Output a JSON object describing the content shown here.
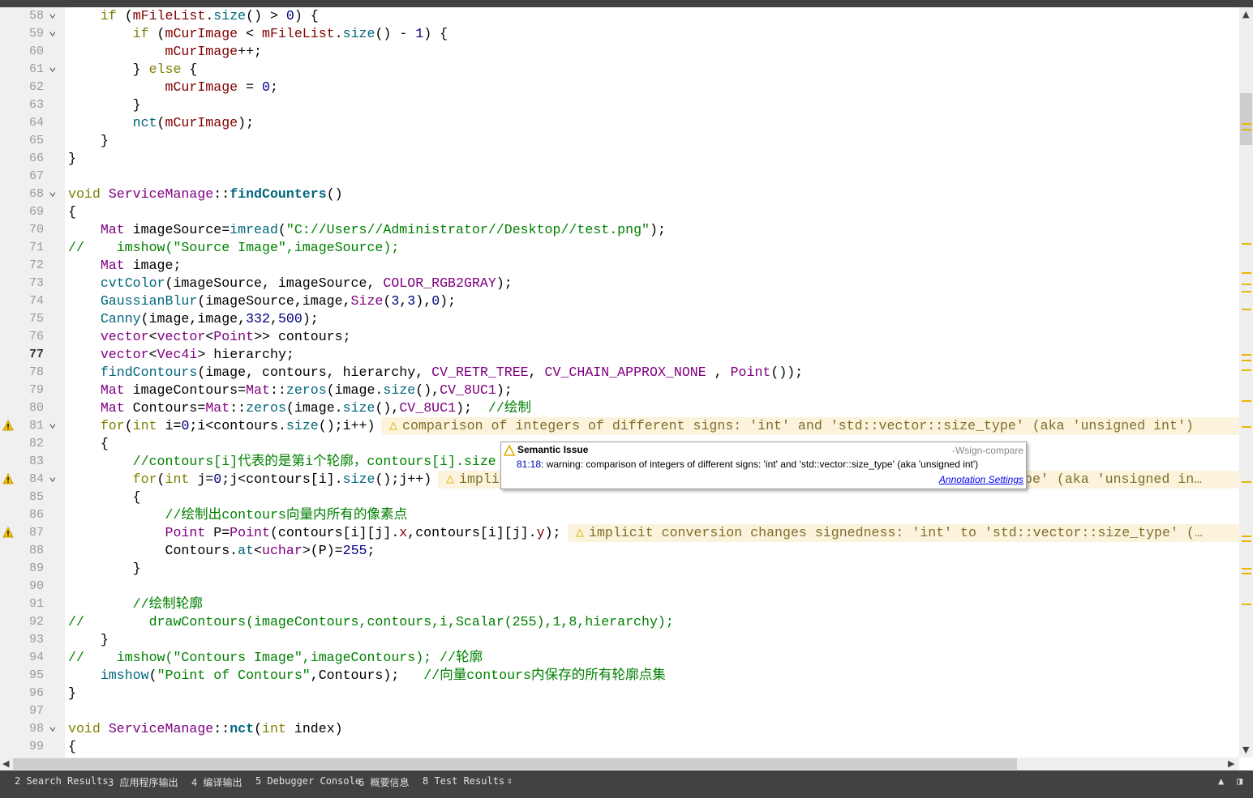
{
  "editor": {
    "current_line": 77,
    "fold_lines": [
      58,
      59,
      61,
      68,
      81,
      84,
      98
    ],
    "warning_lines": [
      81,
      84,
      87
    ],
    "lines": [
      {
        "n": 58,
        "t": [
          [
            "p",
            "    "
          ],
          [
            "k",
            "if"
          ],
          [
            "p",
            " ("
          ],
          [
            "m",
            "mFileList"
          ],
          [
            "p",
            "."
          ],
          [
            "f",
            "size"
          ],
          [
            "p",
            "() > "
          ],
          [
            "n",
            "0"
          ],
          [
            "p",
            ") {"
          ]
        ]
      },
      {
        "n": 59,
        "t": [
          [
            "p",
            "        "
          ],
          [
            "k",
            "if"
          ],
          [
            "p",
            " ("
          ],
          [
            "m",
            "mCurImage"
          ],
          [
            "p",
            " < "
          ],
          [
            "m",
            "mFileList"
          ],
          [
            "p",
            "."
          ],
          [
            "f",
            "size"
          ],
          [
            "p",
            "() - "
          ],
          [
            "n",
            "1"
          ],
          [
            "p",
            ") {"
          ]
        ]
      },
      {
        "n": 60,
        "t": [
          [
            "p",
            "            "
          ],
          [
            "m",
            "mCurImage"
          ],
          [
            "p",
            "++;"
          ]
        ]
      },
      {
        "n": 61,
        "t": [
          [
            "p",
            "        } "
          ],
          [
            "k",
            "else"
          ],
          [
            "p",
            " {"
          ]
        ]
      },
      {
        "n": 62,
        "t": [
          [
            "p",
            "            "
          ],
          [
            "m",
            "mCurImage"
          ],
          [
            "p",
            " = "
          ],
          [
            "n",
            "0"
          ],
          [
            "p",
            ";"
          ]
        ]
      },
      {
        "n": 63,
        "t": [
          [
            "p",
            "        }"
          ]
        ]
      },
      {
        "n": 64,
        "t": [
          [
            "p",
            "        "
          ],
          [
            "f",
            "nct"
          ],
          [
            "p",
            "("
          ],
          [
            "m",
            "mCurImage"
          ],
          [
            "p",
            ");"
          ]
        ]
      },
      {
        "n": 65,
        "t": [
          [
            "p",
            "    }"
          ]
        ]
      },
      {
        "n": 66,
        "t": [
          [
            "p",
            "}"
          ]
        ]
      },
      {
        "n": 67,
        "t": []
      },
      {
        "n": 68,
        "t": [
          [
            "k",
            "void"
          ],
          [
            "p",
            " "
          ],
          [
            "t",
            "ServiceManage"
          ],
          [
            "p",
            "::"
          ],
          [
            "fb",
            "findCounters"
          ],
          [
            "p",
            "()"
          ]
        ]
      },
      {
        "n": 69,
        "t": [
          [
            "p",
            "{"
          ]
        ]
      },
      {
        "n": 70,
        "t": [
          [
            "p",
            "    "
          ],
          [
            "t",
            "Mat"
          ],
          [
            "p",
            " imageSource="
          ],
          [
            "f",
            "imread"
          ],
          [
            "p",
            "("
          ],
          [
            "s",
            "\"C://Users//Administrator//Desktop//test.png\""
          ],
          [
            "p",
            ");"
          ]
        ]
      },
      {
        "n": 71,
        "t": [
          [
            "c",
            "//    imshow(\"Source Image\",imageSource);"
          ]
        ]
      },
      {
        "n": 72,
        "t": [
          [
            "p",
            "    "
          ],
          [
            "t",
            "Mat"
          ],
          [
            "p",
            " image;"
          ]
        ]
      },
      {
        "n": 73,
        "t": [
          [
            "p",
            "    "
          ],
          [
            "f",
            "cvtColor"
          ],
          [
            "p",
            "(imageSource, imageSource, "
          ],
          [
            "t",
            "COLOR_RGB2GRAY"
          ],
          [
            "p",
            ");"
          ]
        ]
      },
      {
        "n": 74,
        "t": [
          [
            "p",
            "    "
          ],
          [
            "f",
            "GaussianBlur"
          ],
          [
            "p",
            "(imageSource,image,"
          ],
          [
            "t",
            "Size"
          ],
          [
            "p",
            "("
          ],
          [
            "n",
            "3"
          ],
          [
            "p",
            ","
          ],
          [
            "n",
            "3"
          ],
          [
            "p",
            "),"
          ],
          [
            "n",
            "0"
          ],
          [
            "p",
            ");"
          ]
        ]
      },
      {
        "n": 75,
        "t": [
          [
            "p",
            "    "
          ],
          [
            "f",
            "Canny"
          ],
          [
            "p",
            "(image,image,"
          ],
          [
            "n",
            "332"
          ],
          [
            "p",
            ","
          ],
          [
            "n",
            "500"
          ],
          [
            "p",
            ");"
          ]
        ]
      },
      {
        "n": 76,
        "t": [
          [
            "p",
            "    "
          ],
          [
            "t",
            "vector"
          ],
          [
            "p",
            "<"
          ],
          [
            "t",
            "vector"
          ],
          [
            "p",
            "<"
          ],
          [
            "t",
            "Point"
          ],
          [
            "p",
            ">> contours;"
          ]
        ]
      },
      {
        "n": 77,
        "t": [
          [
            "p",
            "    "
          ],
          [
            "t",
            "vector"
          ],
          [
            "p",
            "<"
          ],
          [
            "t",
            "Vec4i"
          ],
          [
            "p",
            "> hierarchy;"
          ]
        ]
      },
      {
        "n": 78,
        "t": [
          [
            "p",
            "    "
          ],
          [
            "f",
            "findContours"
          ],
          [
            "p",
            "(image, contours, hierarchy, "
          ],
          [
            "t",
            "CV_RETR_TREE"
          ],
          [
            "p",
            ", "
          ],
          [
            "t",
            "CV_CHAIN_APPROX_NONE"
          ],
          [
            "p",
            " , "
          ],
          [
            "t",
            "Point"
          ],
          [
            "p",
            "());"
          ]
        ]
      },
      {
        "n": 79,
        "t": [
          [
            "p",
            "    "
          ],
          [
            "t",
            "Mat"
          ],
          [
            "p",
            " imageContours="
          ],
          [
            "t",
            "Mat"
          ],
          [
            "p",
            "::"
          ],
          [
            "f",
            "zeros"
          ],
          [
            "p",
            "(image."
          ],
          [
            "f",
            "size"
          ],
          [
            "p",
            "(),"
          ],
          [
            "t",
            "CV_8UC1"
          ],
          [
            "p",
            ");"
          ]
        ]
      },
      {
        "n": 80,
        "t": [
          [
            "p",
            "    "
          ],
          [
            "t",
            "Mat"
          ],
          [
            "p",
            " Contours="
          ],
          [
            "t",
            "Mat"
          ],
          [
            "p",
            "::"
          ],
          [
            "f",
            "zeros"
          ],
          [
            "p",
            "(image."
          ],
          [
            "f",
            "size"
          ],
          [
            "p",
            "(),"
          ],
          [
            "t",
            "CV_8UC1"
          ],
          [
            "p",
            ");  "
          ],
          [
            "c",
            "//绘制"
          ]
        ]
      },
      {
        "n": 81,
        "t": [
          [
            "p",
            "    "
          ],
          [
            "k",
            "for"
          ],
          [
            "p",
            "("
          ],
          [
            "k",
            "int"
          ],
          [
            "p",
            " i="
          ],
          [
            "n",
            "0"
          ],
          [
            "p",
            ";i<contours."
          ],
          [
            "f",
            "size"
          ],
          [
            "p",
            "();i++)"
          ]
        ],
        "ann": "comparison of integers of different signs: 'int' and 'std::vector::size_type' (aka 'unsigned int')"
      },
      {
        "n": 82,
        "t": [
          [
            "p",
            "    {"
          ]
        ]
      },
      {
        "n": 83,
        "t": [
          [
            "p",
            "        "
          ],
          [
            "c",
            "//contours[i]代表的是第i个轮廓，contours[i].size"
          ]
        ]
      },
      {
        "n": 84,
        "t": [
          [
            "p",
            "        "
          ],
          [
            "k",
            "for"
          ],
          [
            "p",
            "("
          ],
          [
            "k",
            "int"
          ],
          [
            "p",
            " j="
          ],
          [
            "n",
            "0"
          ],
          [
            "p",
            ";j<contours[i]."
          ],
          [
            "f",
            "size"
          ],
          [
            "p",
            "();j++)"
          ]
        ],
        "ann": "implicit conversion changes signedness: 'int' to 'std::vector::size_type' (aka 'unsigned in…"
      },
      {
        "n": 85,
        "t": [
          [
            "p",
            "        {"
          ]
        ]
      },
      {
        "n": 86,
        "t": [
          [
            "p",
            "            "
          ],
          [
            "c",
            "//绘制出contours向量内所有的像素点"
          ]
        ]
      },
      {
        "n": 87,
        "t": [
          [
            "p",
            "            "
          ],
          [
            "t",
            "Point"
          ],
          [
            "p",
            " P="
          ],
          [
            "t",
            "Point"
          ],
          [
            "p",
            "(contours[i][j]."
          ],
          [
            "m",
            "x"
          ],
          [
            "p",
            ",contours[i][j]."
          ],
          [
            "m",
            "y"
          ],
          [
            "p",
            ");"
          ]
        ],
        "ann": "implicit conversion changes signedness: 'int' to 'std::vector::size_type' (…"
      },
      {
        "n": 88,
        "t": [
          [
            "p",
            "            Contours."
          ],
          [
            "f",
            "at"
          ],
          [
            "p",
            "<"
          ],
          [
            "t",
            "uchar"
          ],
          [
            "p",
            ">(P)="
          ],
          [
            "n",
            "255"
          ],
          [
            "p",
            ";"
          ]
        ]
      },
      {
        "n": 89,
        "t": [
          [
            "p",
            "        }"
          ]
        ]
      },
      {
        "n": 90,
        "t": []
      },
      {
        "n": 91,
        "t": [
          [
            "p",
            "        "
          ],
          [
            "c",
            "//绘制轮廓"
          ]
        ]
      },
      {
        "n": 92,
        "t": [
          [
            "c",
            "//        drawContours(imageContours,contours,i,Scalar(255),1,8,hierarchy);"
          ]
        ]
      },
      {
        "n": 93,
        "t": [
          [
            "p",
            "    }"
          ]
        ]
      },
      {
        "n": 94,
        "t": [
          [
            "c",
            "//    imshow(\"Contours Image\",imageContours); //轮廓"
          ]
        ]
      },
      {
        "n": 95,
        "t": [
          [
            "p",
            "    "
          ],
          [
            "f",
            "imshow"
          ],
          [
            "p",
            "("
          ],
          [
            "s",
            "\"Point of Contours\""
          ],
          [
            "p",
            ",Contours);   "
          ],
          [
            "c",
            "//向量contours内保存的所有轮廓点集"
          ]
        ]
      },
      {
        "n": 96,
        "t": [
          [
            "p",
            "}"
          ]
        ]
      },
      {
        "n": 97,
        "t": []
      },
      {
        "n": 98,
        "t": [
          [
            "k",
            "void"
          ],
          [
            "p",
            " "
          ],
          [
            "t",
            "ServiceManage"
          ],
          [
            "p",
            "::"
          ],
          [
            "fb",
            "nct"
          ],
          [
            "p",
            "("
          ],
          [
            "k",
            "int"
          ],
          [
            "p",
            " index)"
          ]
        ]
      },
      {
        "n": 99,
        "t": [
          [
            "p",
            "{"
          ]
        ]
      }
    ]
  },
  "tooltip": {
    "title": "Semantic Issue",
    "flag": "-Wsign-compare",
    "location": "81:18",
    "message": ": warning: comparison of integers of different signs: 'int' and 'std::vector::size_type' (aka 'unsigned int')",
    "link": "Annotation Settings"
  },
  "output_tabs": [
    {
      "label": "2 Search Results"
    },
    {
      "label": "3 应用程序输出"
    },
    {
      "label": "4 编译输出"
    },
    {
      "label": "5 Debugger Console"
    },
    {
      "label": "6 概要信息"
    },
    {
      "label": "8 Test Results"
    }
  ],
  "colors": {
    "warning": "#e8b800",
    "keyword": "#808000",
    "type": "#800080",
    "function": "#00677c",
    "string": "#008000",
    "number": "#000080",
    "member": "#800000"
  },
  "icons": {
    "warning": "warning-triangle-icon",
    "fold": "chevron-down-icon"
  }
}
